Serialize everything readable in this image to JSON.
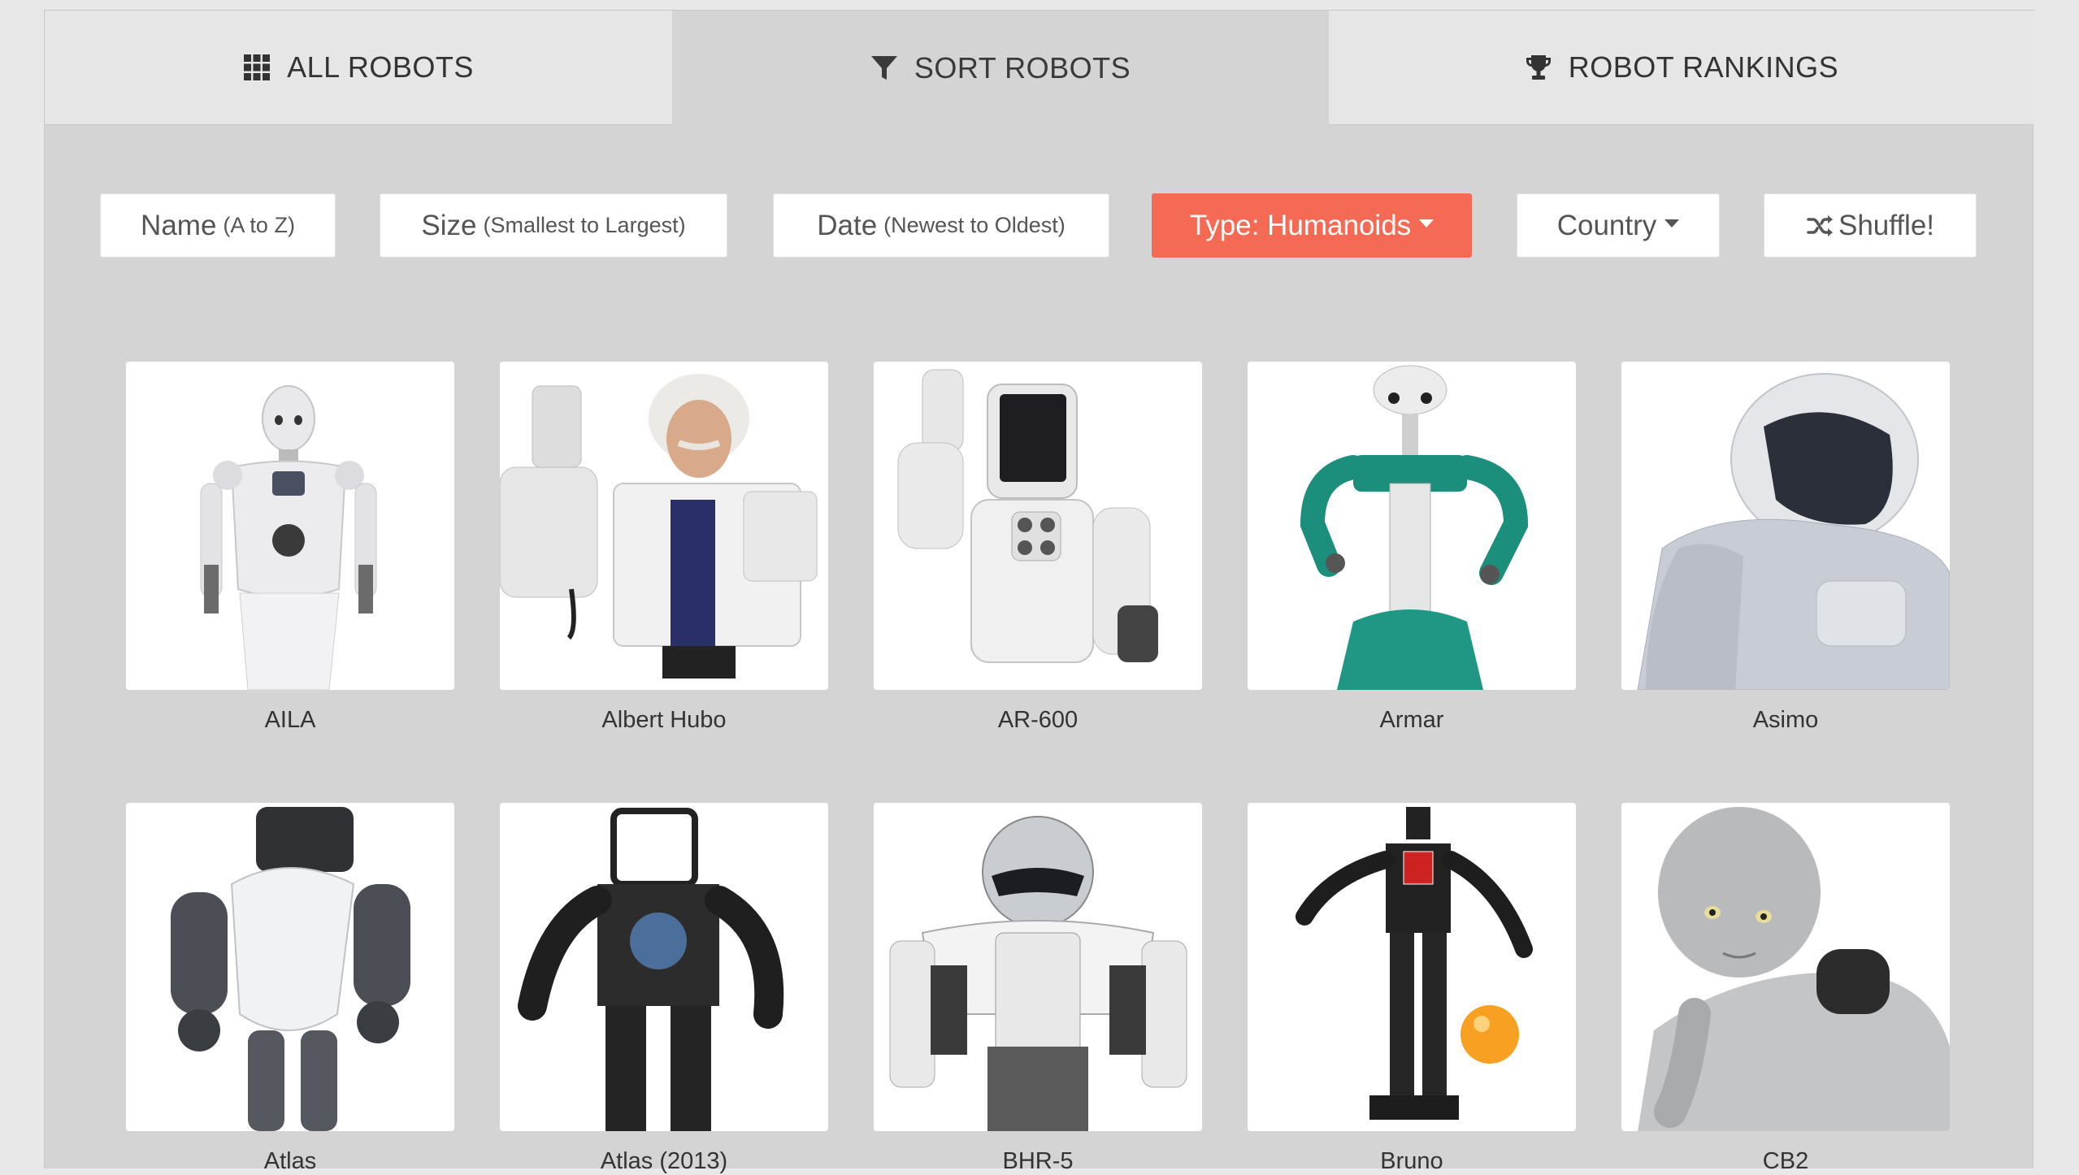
{
  "tabs": [
    {
      "label": "ALL ROBOTS",
      "icon": "grid-icon",
      "active": false
    },
    {
      "label": "SORT ROBOTS",
      "icon": "filter-icon",
      "active": true
    },
    {
      "label": "ROBOT RANKINGS",
      "icon": "trophy-icon",
      "active": false
    }
  ],
  "sort_buttons": {
    "name": {
      "label": "Name",
      "sub": "(A to Z)"
    },
    "size": {
      "label": "Size",
      "sub": "(Smallest to Largest)"
    },
    "date": {
      "label": "Date",
      "sub": "(Newest to Oldest)"
    },
    "type": {
      "label": "Type: Humanoids",
      "active": true
    },
    "country": {
      "label": "Country"
    },
    "shuffle": {
      "label": "Shuffle!",
      "icon": "shuffle-icon"
    }
  },
  "colors": {
    "accent": "#f56a55",
    "panel": "#d4d4d4",
    "tab_inactive": "#e6e6e6"
  },
  "robots": [
    {
      "name": "AILA"
    },
    {
      "name": "Albert Hubo"
    },
    {
      "name": "AR-600"
    },
    {
      "name": "Armar"
    },
    {
      "name": "Asimo"
    },
    {
      "name": "Atlas"
    },
    {
      "name": "Atlas (2013)"
    },
    {
      "name": "BHR-5"
    },
    {
      "name": "Bruno"
    },
    {
      "name": "CB2"
    }
  ]
}
